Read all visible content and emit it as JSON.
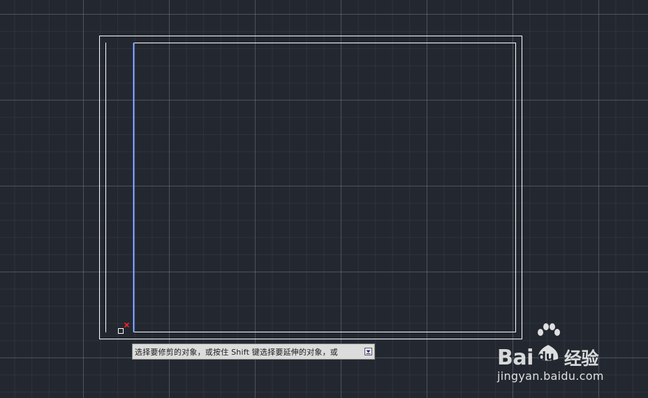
{
  "app": {
    "background_color": "#232830",
    "grid_color": "#8c96a5"
  },
  "drawing": {
    "line_color": "#ffffff",
    "selected_line_color": "#5a82ff",
    "marker_color": "#ff2020"
  },
  "tooltip": {
    "prompt_text": "选择要修剪的对象，或按住 Shift 键选择要延伸的对象，或",
    "expand_icon": "down-arrow-icon"
  },
  "watermark": {
    "brand_prefix": "Bai",
    "brand_du": "du",
    "brand_suffix": "经验",
    "url": "jingyan.baidu.com"
  }
}
